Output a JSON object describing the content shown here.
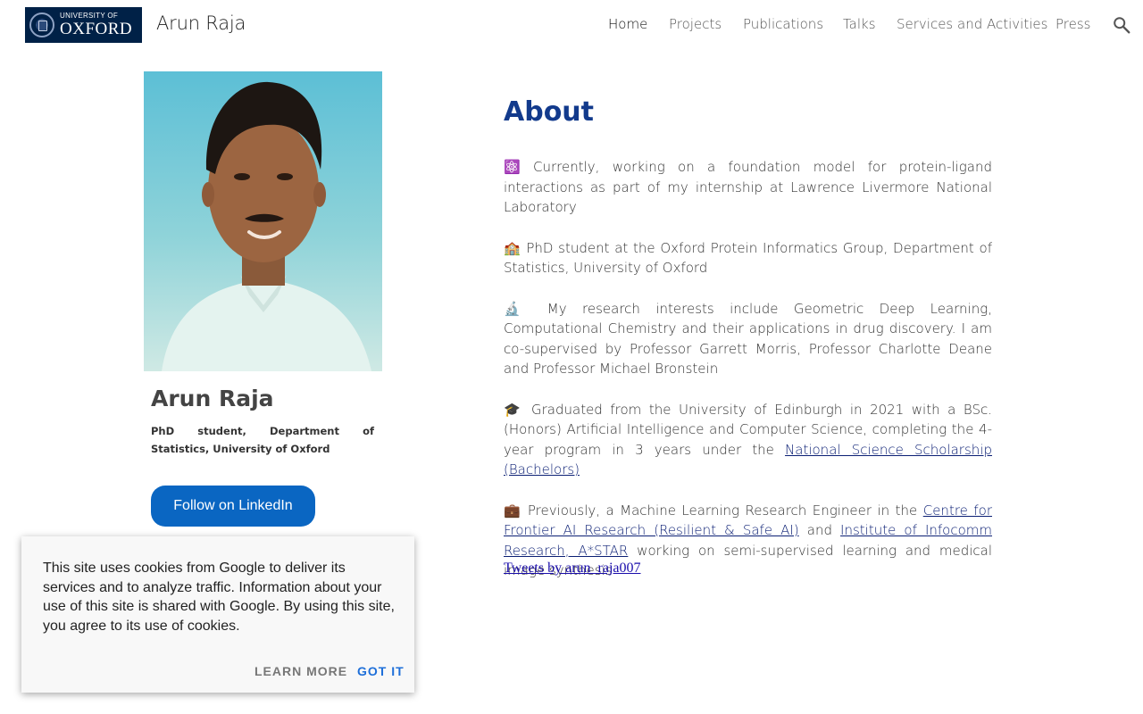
{
  "header": {
    "logo": {
      "top": "UNIVERSITY OF",
      "main": "OXFORD"
    },
    "site_title": "Arun Raja",
    "nav": [
      "Home",
      "Projects",
      "Publications",
      "Talks",
      "Services and Activities",
      "Press"
    ],
    "search_icon": "search-icon"
  },
  "profile": {
    "name": "Arun Raja",
    "subtitle": "PhD student, Department of Statistics, University of Oxford",
    "linkedin_label": "Follow on LinkedIn"
  },
  "about": {
    "title": "About",
    "p1": {
      "emoji": "⚛️",
      "text": " Currently, working on  a foundation model for protein-ligand interactions as part of my internship at Lawrence Livermore National Laboratory"
    },
    "p2": {
      "emoji": "🏫",
      "text": " PhD student at the Oxford Protein Informatics Group, Department of Statistics, University of Oxford"
    },
    "p3": {
      "emoji": "🔬",
      "text": "  My research interests include Geometric Deep Learning, Computational Chemistry and their applications in drug discovery. I am co-supervised by Professor Garrett Morris, Professor Charlotte Deane and Professor Michael Bronstein"
    },
    "p4": {
      "emoji": "🎓",
      "text": " Graduated from the University of Edinburgh in 2021 with a BSc.(Honors) Artificial Intelligence and Computer Science, completing the 4-year program in 3 years under the ",
      "link": "National Science Scholarship (Bachelors)"
    },
    "p5": {
      "emoji": "💼",
      "text": " Previously, a Machine Learning Research Engineer in the ",
      "link1": "Centre for Frontier AI Research (Resilient & Safe AI)",
      "mid": " and ",
      "link2": "Institute of Infocomm Research, A*STAR",
      "end": " working on semi-supervised learning and medical image synthesis"
    }
  },
  "tweets_link": "Tweets by arun_raja007",
  "cookie": {
    "text": "This site uses cookies from Google to deliver its services and to analyze traffic. Information about your use of this site is shared with Google. By using this site, you agree to its use of cookies.",
    "learn_more": "LEARN MORE",
    "got_it": "GOT IT"
  }
}
